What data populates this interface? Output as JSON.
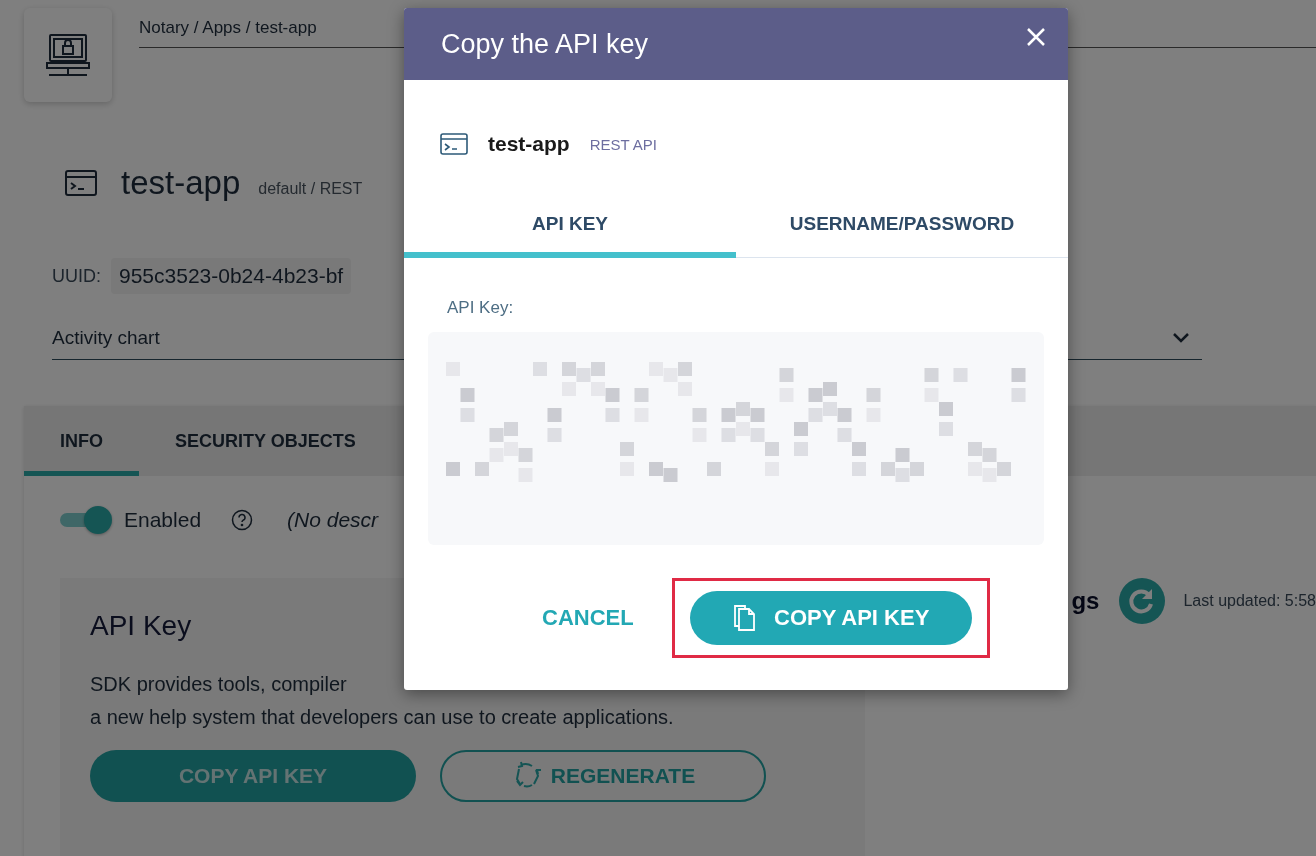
{
  "breadcrumb": "Notary / Apps / test-app",
  "app": {
    "name": "test-app",
    "meta": "default / REST"
  },
  "uuid": {
    "label": "UUID:",
    "value": "955c3523-0b24-4b23-bf"
  },
  "activity_select": {
    "label": "Activity chart"
  },
  "tabs": [
    {
      "label": "INFO",
      "selected": true
    },
    {
      "label": "SECURITY OBJECTS",
      "selected": false
    }
  ],
  "enabled": {
    "on": true,
    "label": "Enabled"
  },
  "description": "(No descr",
  "api_key_card": {
    "title": "API Key",
    "text_lines": [
      "SDK provides tools, compiler",
      "a new help system that developers can use to create applications."
    ],
    "buttons": [
      {
        "label": "COPY API KEY",
        "kind": "filled"
      },
      {
        "label": "REGENERATE",
        "kind": "outline"
      }
    ]
  },
  "logs": {
    "title": "gs",
    "updated": "Last updated: 5:58"
  },
  "dialog": {
    "title": "Copy the API key",
    "app_name": "test-app",
    "app_type": "REST API",
    "tabs": [
      {
        "label": "API KEY",
        "selected": true
      },
      {
        "label": "USERNAME/PASSWORD",
        "selected": false
      }
    ],
    "field_label": "API Key:",
    "cancel": "CANCEL",
    "copy": "COPY API KEY",
    "highlighted": true
  }
}
